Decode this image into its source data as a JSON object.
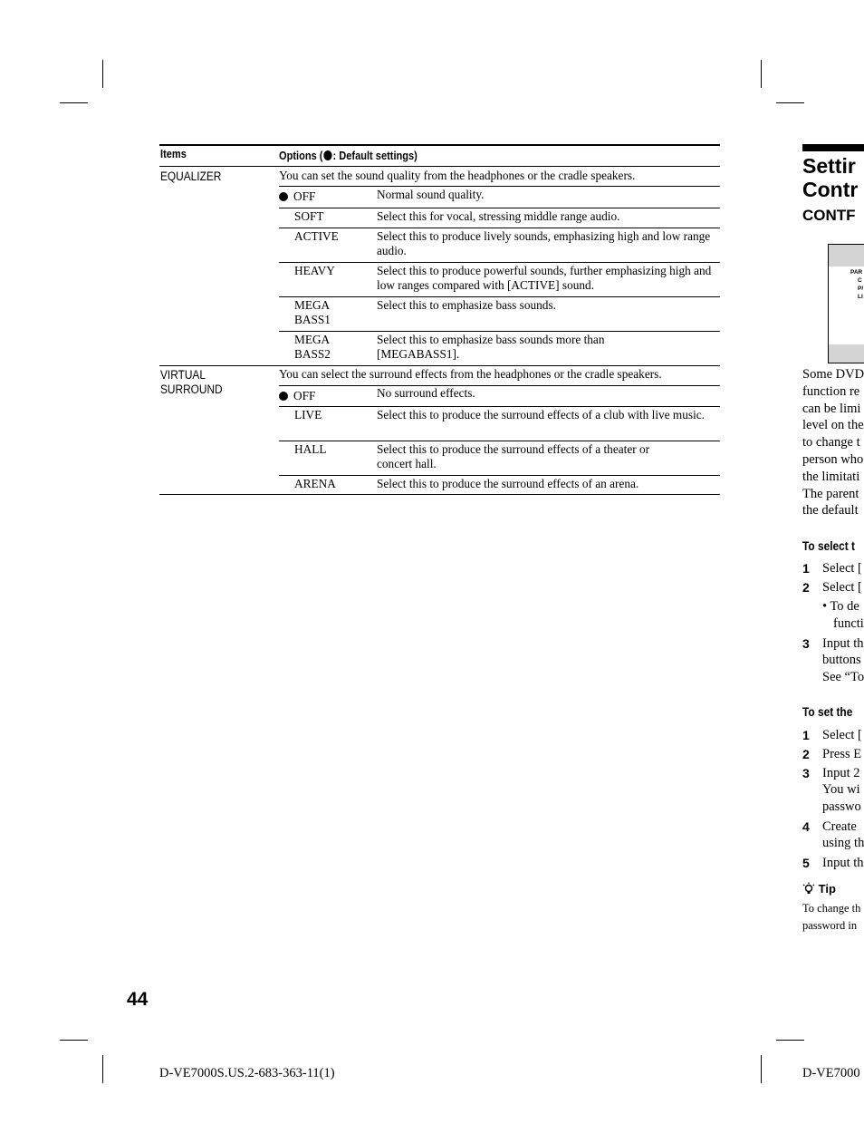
{
  "table": {
    "header": {
      "items": "Items",
      "options_prefix": "Options  (",
      "options_suffix": ": Default settings)"
    },
    "sections": [
      {
        "item": "EQUALIZER",
        "intro": "You can set the sound quality from the headphones or the cradle speakers.",
        "options": [
          {
            "name": "OFF",
            "default": true,
            "desc": "Normal sound quality."
          },
          {
            "name": "SOFT",
            "default": false,
            "desc": "Select this for vocal, stressing middle range audio."
          },
          {
            "name": "ACTIVE",
            "default": false,
            "desc": "Select this to produce lively sounds, emphasizing high and low range audio."
          },
          {
            "name": "HEAVY",
            "default": false,
            "desc": "Select this to produce powerful sounds, further emphasizing high and low ranges compared with [ACTIVE] sound."
          },
          {
            "name": "MEGA BASS1",
            "default": false,
            "desc": "Select this to emphasize bass sounds."
          },
          {
            "name": "MEGA BASS2",
            "default": false,
            "desc": "Select this to emphasize bass sounds more than [MEGABASS1]."
          }
        ]
      },
      {
        "item": "VIRTUAL SURROUND",
        "intro": "You can select the surround effects from the headphones or the cradle speakers.",
        "options": [
          {
            "name": "OFF",
            "default": true,
            "desc": "No surround effects."
          },
          {
            "name": "LIVE",
            "default": false,
            "desc": "Select this to produce the surround effects of a club with live music."
          },
          {
            "name": "HALL",
            "default": false,
            "desc": "Select this to produce the surround effects of a theater or concert hall."
          },
          {
            "name": "ARENA",
            "default": false,
            "desc": "Select this to produce the surround effects of an arena."
          }
        ]
      }
    ]
  },
  "right_page": {
    "title_line1": "Settir",
    "title_line2": "Contr",
    "subtitle": "CONTF",
    "screen_lines": [
      "PAR",
      "C",
      "P/",
      "LI"
    ],
    "paragraph": [
      "Some DVD",
      "function re",
      "can be limi",
      "level on the",
      "to change t",
      "person who",
      "the limitati",
      "The parent",
      "the default"
    ],
    "section1_heading": "To select t",
    "section1_steps": [
      {
        "num": "1",
        "text": "Select ["
      },
      {
        "num": "2",
        "text": "Select ["
      },
      {
        "num": "",
        "text": "• To de"
      },
      {
        "num": "",
        "text": "  functi"
      },
      {
        "num": "3",
        "text": "Input th"
      },
      {
        "num": "",
        "text": "buttons"
      },
      {
        "num": "",
        "text": "See “To"
      }
    ],
    "section2_heading": "To set the",
    "section2_steps": [
      {
        "num": "1",
        "text": "Select ["
      },
      {
        "num": "2",
        "text": "Press E"
      },
      {
        "num": "3",
        "text": "Input 2"
      },
      {
        "num": "",
        "text": "You wi"
      },
      {
        "num": "",
        "text": "passwo"
      },
      {
        "num": "4",
        "text": "Create"
      },
      {
        "num": "",
        "text": "using th"
      },
      {
        "num": "5",
        "text": "Input th"
      }
    ],
    "tip_label": "Tip",
    "tip_lines": [
      "To change th",
      "password in"
    ]
  },
  "page_number": "44",
  "footer_left": "D-VE7000S.US.2-683-363-11(1)",
  "footer_right": "D-VE7000"
}
